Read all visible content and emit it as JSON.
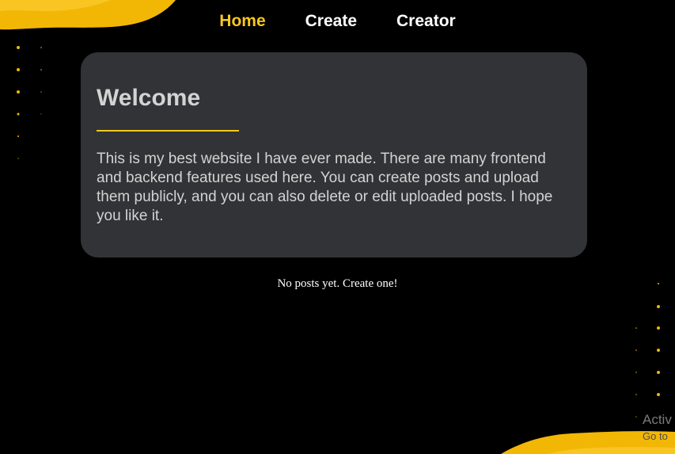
{
  "nav": {
    "items": [
      {
        "label": "Home",
        "active": true
      },
      {
        "label": "Create",
        "active": false
      },
      {
        "label": "Creator",
        "active": false
      }
    ]
  },
  "welcome": {
    "title": "Welcome",
    "body": "This is my best website I have ever made. There are many frontend and backend features used here. You can create posts and upload them publicly, and you can also delete or edit uploaded posts. I hope you like it."
  },
  "posts": {
    "empty_message": "No posts yet. Create one!"
  },
  "os_overlay": {
    "line1": "Activ",
    "line2": "Go to"
  },
  "colors": {
    "background": "#000000",
    "accent": "#f7c81e",
    "card": "#323336",
    "card_text": "#d3d3d3"
  }
}
